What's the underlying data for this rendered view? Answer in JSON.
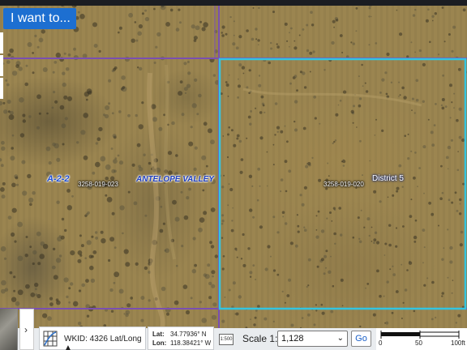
{
  "map": {
    "i_want_to": "I want to...",
    "labels": {
      "zone": "A-2-2",
      "community": "ANTELOPE VALLEY",
      "parcel_left": "3258-019-023",
      "parcel_right": "3258-019-020",
      "district": "District 5"
    },
    "colors": {
      "parcel_line": "#7a4fb0",
      "district_boundary": "#33c4e0",
      "button_blue": "#1d6fd1"
    }
  },
  "toolbar": {
    "overview_toggle_icon": "chevron-right-icon",
    "wkid": "WKID: 4326 Lat/Long",
    "wkid_caret": "▲",
    "lat_label": "Lat:",
    "lat_value": "34.77936° N",
    "lon_label": "Lon:",
    "lon_value": "118.38421° W",
    "scale_icon_text": "1:500",
    "scale_label": "Scale 1:",
    "scale_value": "1,128",
    "go": "Go",
    "scalebar_ticks": [
      "0",
      "50",
      "100ft"
    ]
  }
}
